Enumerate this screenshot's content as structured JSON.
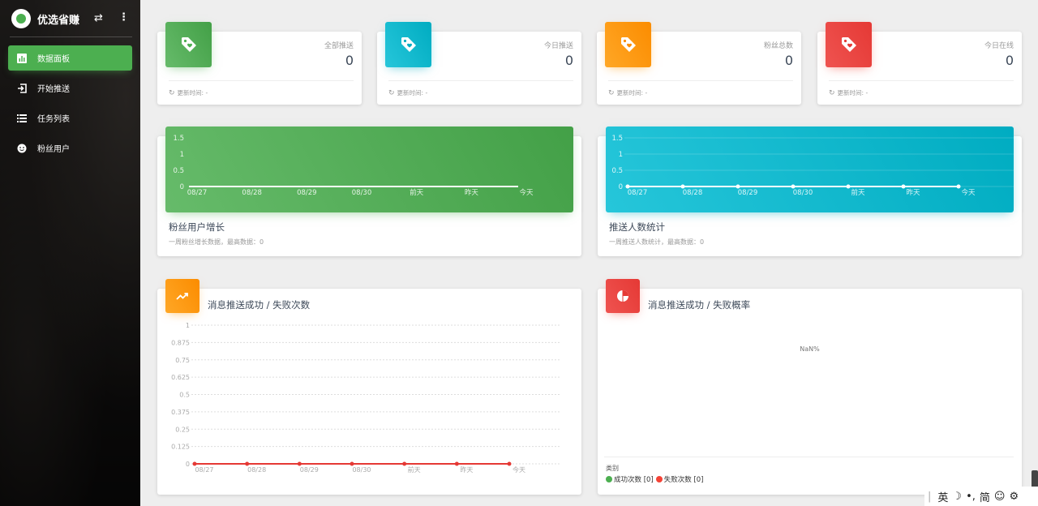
{
  "app": {
    "name": "优选省赚"
  },
  "sidebar": {
    "items": [
      {
        "label": "数据面板",
        "icon": "bar-chart-icon",
        "active": true
      },
      {
        "label": "开始推送",
        "icon": "login-icon",
        "active": false
      },
      {
        "label": "任务列表",
        "icon": "list-icon",
        "active": false
      },
      {
        "label": "粉丝用户",
        "icon": "face-icon",
        "active": false
      }
    ]
  },
  "stats": [
    {
      "label": "全部推送",
      "value": "0",
      "footer": "更新时间: -",
      "color": "#4caf50"
    },
    {
      "label": "今日推送",
      "value": "0",
      "footer": "更新时间: -",
      "color": "#00acc1"
    },
    {
      "label": "粉丝总数",
      "value": "0",
      "footer": "更新时间: -",
      "color": "#ff9800"
    },
    {
      "label": "今日在线",
      "value": "0",
      "footer": "更新时间: -",
      "color": "#f44336"
    }
  ],
  "fans_chart": {
    "title": "粉丝用户增长",
    "subtitle": "一周粉丝增长数据，最高数据：0"
  },
  "push_chart": {
    "title": "推送人数统计",
    "subtitle": "一周推送人数统计，最高数据：0"
  },
  "msg_chart": {
    "title": "消息推送成功 / 失败次数"
  },
  "pie_chart": {
    "title": "消息推送成功 / 失败概率",
    "center_label": "NaN%",
    "legend_title": "类别",
    "legend": [
      {
        "label": "成功次数 [0]",
        "color": "#4caf50"
      },
      {
        "label": "失败次数 [0]",
        "color": "#f44336"
      }
    ]
  },
  "ime": {
    "items": [
      "英",
      "☽",
      "•,",
      "简",
      "☺",
      "⚙"
    ]
  },
  "chart_data": [
    {
      "type": "line",
      "categories": [
        "08/27",
        "08/28",
        "08/29",
        "08/30",
        "前天",
        "昨天",
        "今天"
      ],
      "series": [
        {
          "values": [
            0,
            0,
            0,
            0,
            0,
            0,
            0
          ]
        }
      ],
      "yticks": [
        "1.5",
        "1",
        "0.5",
        "0"
      ],
      "ylim": [
        0,
        1.5
      ],
      "grid": false,
      "color": "#ffffff"
    },
    {
      "type": "line",
      "categories": [
        "08/27",
        "08/28",
        "08/29",
        "08/30",
        "前天",
        "昨天",
        "今天"
      ],
      "series": [
        {
          "values": [
            0,
            0,
            0,
            0,
            0,
            0,
            0
          ]
        }
      ],
      "yticks": [
        "1.5",
        "1",
        "0.5",
        "0"
      ],
      "ylim": [
        0,
        1.5
      ],
      "grid": true,
      "color": "#ffffff"
    },
    {
      "type": "line",
      "categories": [
        "08/27",
        "08/28",
        "08/29",
        "08/30",
        "前天",
        "昨天",
        "今天"
      ],
      "series": [
        {
          "values": [
            0,
            0,
            0,
            0,
            0,
            0,
            0
          ]
        }
      ],
      "yticks": [
        "1",
        "0.875",
        "0.75",
        "0.625",
        "0.5",
        "0.375",
        "0.25",
        "0.125",
        "0"
      ],
      "ylim": [
        0,
        1
      ],
      "grid": true,
      "color": "#e53935"
    },
    {
      "type": "pie",
      "categories": [
        "成功次数",
        "失败次数"
      ],
      "values": [
        0,
        0
      ],
      "center_label": "NaN%"
    }
  ]
}
